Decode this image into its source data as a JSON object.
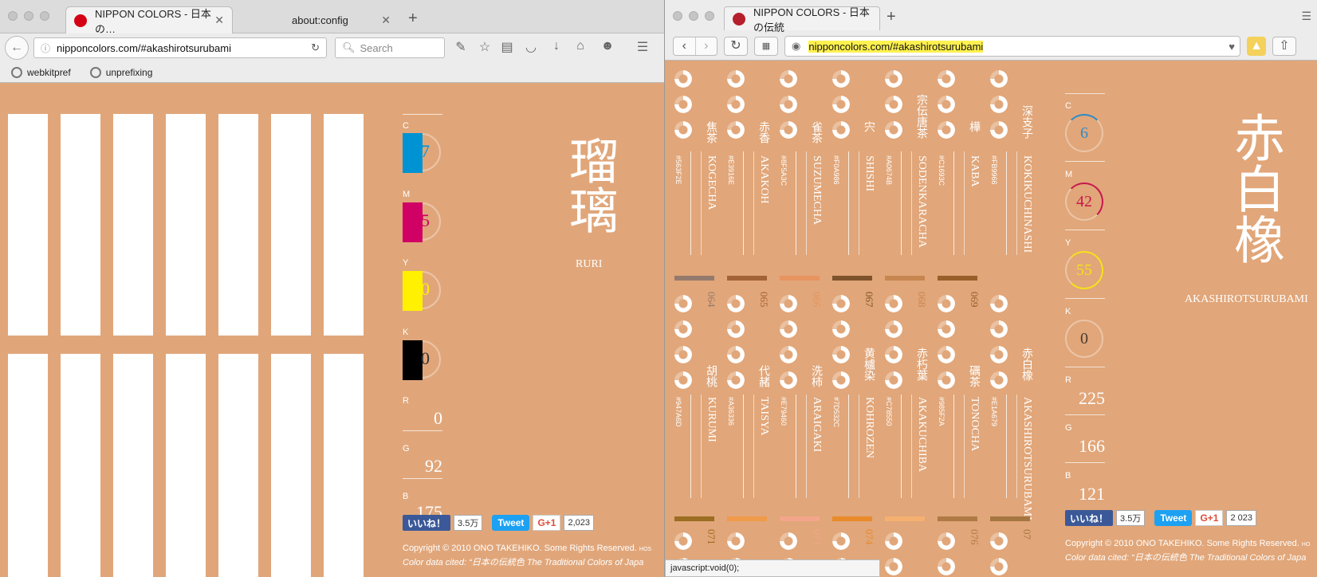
{
  "left_window": {
    "tabs": [
      {
        "label": "NIPPON COLORS - 日本の…",
        "active": true
      },
      {
        "label": "about:config",
        "active": false
      }
    ],
    "url": "nipponcolors.com/#akashirotsurubami",
    "search_placeholder": "Search",
    "bookmarks": [
      "webkitpref",
      "unprefixing"
    ],
    "cmyk": [
      {
        "label": "C",
        "value": "7",
        "color": "#0093d3"
      },
      {
        "label": "M",
        "value": "5",
        "color": "#d00064"
      },
      {
        "label": "Y",
        "value": "0",
        "color": "#fff100"
      },
      {
        "label": "K",
        "value": "0",
        "color": "#000000"
      }
    ],
    "rgb": [
      {
        "label": "R",
        "value": "0"
      },
      {
        "label": "G",
        "value": "92"
      },
      {
        "label": "B",
        "value": "175"
      }
    ],
    "color_kanji": "瑠璃",
    "color_romaji": "RURI",
    "like_label": "いいね！",
    "like_count": "3.5万",
    "tweet_label": "Tweet",
    "gplus_label": "G+1",
    "gplus_count": "2,023",
    "copyright": "Copyright © 2010 ONO TAKEHIKO. Some Rights Reserved.",
    "copyright_suffix": "HOS",
    "cited": "Color data cited: “日本の伝統色 The Traditional Colors of Japa"
  },
  "right_window": {
    "tab_label": "NIPPON COLORS - 日本の伝統",
    "url": "nipponcolors.com/#akashirotsurubami",
    "colors_row1": [
      {
        "kanji": "焦茶",
        "romaji": "KOGECHA",
        "hex": "#563F2E"
      },
      {
        "kanji": "赤香",
        "romaji": "AKAKOH",
        "hex": "#E3916E"
      },
      {
        "kanji": "雀茶",
        "romaji": "SUZUMECHA",
        "hex": "#8F5A3C"
      },
      {
        "kanji": "宍",
        "romaji": "SHISHI",
        "hex": "#F0A986"
      },
      {
        "kanji": "宗伝唐茶",
        "romaji": "SODENKARACHA",
        "hex": "#A0674B"
      },
      {
        "kanji": "樺",
        "romaji": "KABA",
        "hex": "#C1693C"
      },
      {
        "kanji": "深支子",
        "romaji": "KOKIKUCHINASHI",
        "hex": "#FB9966"
      }
    ],
    "colors_row2": [
      {
        "num": "064",
        "kanji": "胡桃",
        "romaji": "KURUMI",
        "hex": "#947A6D",
        "bar": "#947a6d"
      },
      {
        "num": "065",
        "kanji": "代赭",
        "romaji": "TAISYA",
        "hex": "#A36336",
        "bar": "#a36336"
      },
      {
        "num": "066",
        "kanji": "洗柿",
        "romaji": "ARAIGAKI",
        "hex": "#E79460",
        "bar": "#e79460"
      },
      {
        "num": "067",
        "kanji": "黄櫨染",
        "romaji": "KOHROZEN",
        "hex": "#7D532C",
        "bar": "#7d532c"
      },
      {
        "num": "068",
        "kanji": "赤朽葉",
        "romaji": "AKAKUCHIBA",
        "hex": "#C78550",
        "bar": "#c78550"
      },
      {
        "num": "069",
        "kanji": "礪茶",
        "romaji": "TONOCHA",
        "hex": "#985F2A",
        "bar": "#985f2a"
      },
      {
        "num": "",
        "kanji": "赤白橡",
        "romaji": "AKASHIROTSURUBAMI",
        "hex": "#E1A679",
        "bar": ""
      }
    ],
    "row3_nums": [
      "071",
      "",
      "073",
      "074",
      "",
      "076",
      "07"
    ],
    "row3_bars": [
      "#9b6e23",
      "#f09a4a",
      "#f3a68c",
      "#e98b2a",
      "#f5b070",
      "#b07a44",
      "#a67641"
    ],
    "cmyk": [
      {
        "label": "C",
        "value": "6",
        "color": "#2b8cc8"
      },
      {
        "label": "M",
        "value": "42",
        "color": "#c8174f"
      },
      {
        "label": "Y",
        "value": "55",
        "color": "#f5e21c"
      },
      {
        "label": "K",
        "value": "0",
        "color": "#4a3a30"
      }
    ],
    "rgb": [
      {
        "label": "R",
        "value": "225"
      },
      {
        "label": "G",
        "value": "166"
      },
      {
        "label": "B",
        "value": "121"
      }
    ],
    "color_kanji": "赤白橡",
    "color_romaji": "AKASHIROTSURUBAMI",
    "like_label": "いいね！",
    "like_count": "3.5万",
    "tweet_label": "Tweet",
    "gplus_label": "G+1",
    "gplus_count": "2 023",
    "copyright": "Copyright © 2010 ONO TAKEHIKO. Some Rights Reserved.",
    "copyright_suffix": "HO",
    "cited": "Color data cited: “日本の伝統色 The Traditional Colors of Japa",
    "status": "javascript:void(0);"
  }
}
